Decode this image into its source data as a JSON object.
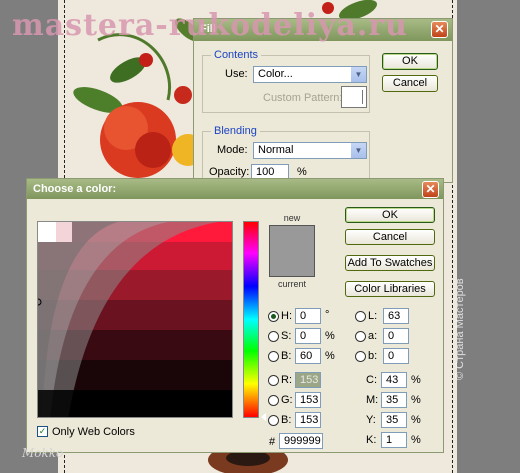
{
  "watermarks": {
    "top": "mastera-rukodeliya.ru",
    "side": "© Страна Мастеров",
    "bottom": "Mokko"
  },
  "fill_dialog": {
    "title": "Fill",
    "contents_label": "Contents",
    "use_label": "Use:",
    "use_value": "Color...",
    "custom_pattern_label": "Custom Pattern:",
    "blending_label": "Blending",
    "mode_label": "Mode:",
    "mode_value": "Normal",
    "opacity_label": "Opacity:",
    "opacity_value": "100",
    "opacity_unit": "%",
    "ok_label": "OK",
    "cancel_label": "Cancel"
  },
  "picker": {
    "title": "Choose a color:",
    "new_label": "new",
    "current_label": "current",
    "buttons": {
      "ok": "OK",
      "cancel": "Cancel",
      "add_swatches": "Add To Swatches",
      "color_libraries": "Color Libraries"
    },
    "hsb": {
      "h_label": "H:",
      "h_value": "0",
      "h_unit": "°",
      "s_label": "S:",
      "s_value": "0",
      "s_unit": "%",
      "b_label": "B:",
      "b_value": "60",
      "b_unit": "%"
    },
    "rgb": {
      "r_label": "R:",
      "r_value": "153",
      "g_label": "G:",
      "g_value": "153",
      "b_label": "B:",
      "b_value": "153"
    },
    "lab": {
      "l_label": "L:",
      "l_value": "63",
      "a_label": "a:",
      "a_value": "0",
      "b_label": "b:",
      "b_value": "0"
    },
    "cmyk": {
      "c_label": "C:",
      "c_value": "43",
      "c_unit": "%",
      "m_label": "M:",
      "m_value": "35",
      "m_unit": "%",
      "y_label": "Y:",
      "y_value": "35",
      "y_unit": "%",
      "k_label": "K:",
      "k_value": "1",
      "k_unit": "%"
    },
    "hex_label": "#",
    "hex_value": "999999",
    "web_colors_label": "Only Web Colors",
    "web_colors_checked": true,
    "colors": {
      "current": "#999999",
      "new": "#999999"
    }
  }
}
